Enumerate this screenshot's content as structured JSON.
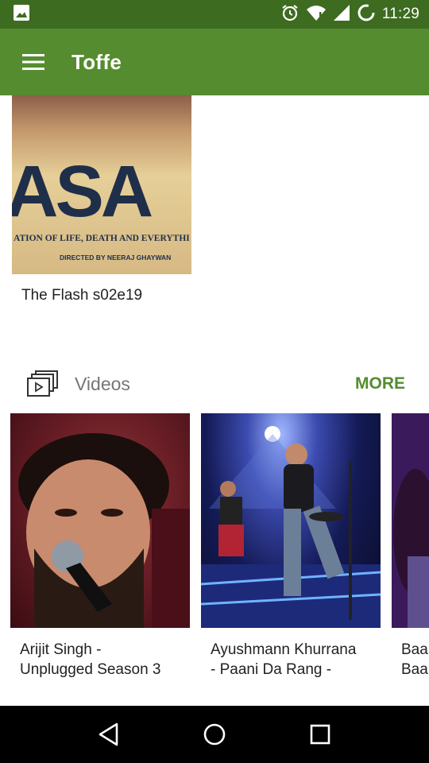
{
  "status_bar": {
    "time": "11:29",
    "icons": [
      "image-icon",
      "alarm-icon",
      "wifi-icon",
      "signal-icon",
      "battery-icon"
    ]
  },
  "app_bar": {
    "title": "Toffe",
    "menu_icon": "hamburger-menu-icon",
    "background": "#548c2f"
  },
  "featured": {
    "caption": "The Flash s02e19",
    "poster_text": {
      "big": "ASA",
      "tagline": "ATION OF LIFE, DEATH AND EVERYTHI",
      "credit": "DIRECTED BY NEERAJ GHAYWAN"
    }
  },
  "videos_section": {
    "title": "Videos",
    "more_label": "MORE",
    "icon": "video-library-icon",
    "items": [
      {
        "title": "Arijit Singh -\nUnplugged Season 3"
      },
      {
        "title": "Ayushmann Khurrana\n- Paani Da Rang -"
      },
      {
        "title": "Baa\nBaa"
      }
    ]
  },
  "nav_bar": {
    "buttons": [
      "back-icon",
      "home-icon",
      "recents-icon"
    ]
  },
  "colors": {
    "status_bar": "#3d6b20",
    "accent": "#548c2f"
  }
}
